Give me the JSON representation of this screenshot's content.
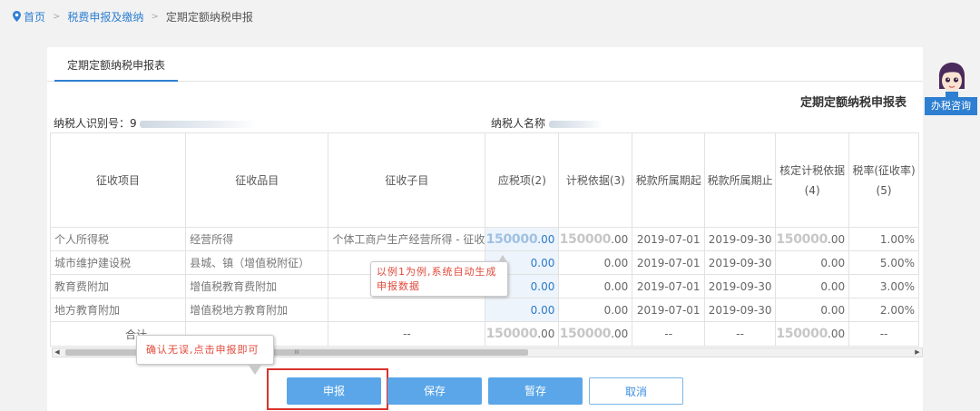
{
  "breadcrumb": {
    "home": "首页",
    "section": "税费申报及缴纳",
    "current": "定期定额纳税申报"
  },
  "tab": {
    "label": "定期定额纳税申报表"
  },
  "form": {
    "title": "定期定额纳税申报表",
    "taxpayer_id_label": "纳税人识别号：",
    "taxpayer_id_value": "9",
    "taxpayer_name_label": "纳税人名称"
  },
  "table": {
    "headers": [
      [
        "征收项目"
      ],
      [
        "征收品目"
      ],
      [
        "征收子目"
      ],
      [
        "应税项(2)"
      ],
      [
        "计税依据(3)"
      ],
      [
        "税款所属期起"
      ],
      [
        "税款所属期止"
      ],
      [
        "核定计税依据",
        "(4)"
      ],
      [
        "税率(征收率)",
        "(5)"
      ]
    ],
    "rows": [
      {
        "item": "个人所得税",
        "category": "经营所得",
        "sub": "个体工商户生产经营所得 - 征收",
        "taxable_big": "150000",
        "taxable_tail": ".00",
        "basis_big": "150000",
        "basis_tail": ".00",
        "start": "2019-07-01",
        "end": "2019-09-30",
        "approved_big": "150000",
        "approved_tail": ".00",
        "rate": "1.00%"
      },
      {
        "item": "城市维护建设税",
        "category": "县城、镇（增值税附征）",
        "sub": "",
        "taxable": "0.00",
        "basis": "0.00",
        "start": "2019-07-01",
        "end": "2019-09-30",
        "approved": "0.00",
        "rate": "5.00%"
      },
      {
        "item": "教育费附加",
        "category": "增值税教育费附加",
        "sub": "",
        "taxable": "0.00",
        "basis": "0.00",
        "start": "2019-07-01",
        "end": "2019-09-30",
        "approved": "0.00",
        "rate": "3.00%"
      },
      {
        "item": "地方教育附加",
        "category": "增值税地方教育附加",
        "sub": "",
        "taxable": "0.00",
        "basis": "0.00",
        "start": "2019-07-01",
        "end": "2019-09-30",
        "approved": "0.00",
        "rate": "2.00%"
      }
    ],
    "total": {
      "label": "合计",
      "sub": "--",
      "taxable_big": "150000",
      "taxable_tail": ".00",
      "basis_big": "150000",
      "basis_tail": ".00",
      "start": "--",
      "end": "--",
      "approved_big": "150000",
      "approved_tail": ".00",
      "rate": "--"
    }
  },
  "scrollbar": {
    "grip": "III"
  },
  "callouts": {
    "auto_generate": "以例1为例,系统自动生成申报数据",
    "confirm": "确认无误,点击申报即可"
  },
  "buttons": {
    "submit": "申报",
    "save": "保存",
    "temp_save": "暂存",
    "cancel": "取消"
  },
  "assistant": {
    "label": "办税咨询"
  },
  "colors": {
    "accent": "#2e7fd1",
    "button": "#5aa6e8",
    "callout_text": "#e24a3b",
    "highlight": "#d9322b"
  }
}
